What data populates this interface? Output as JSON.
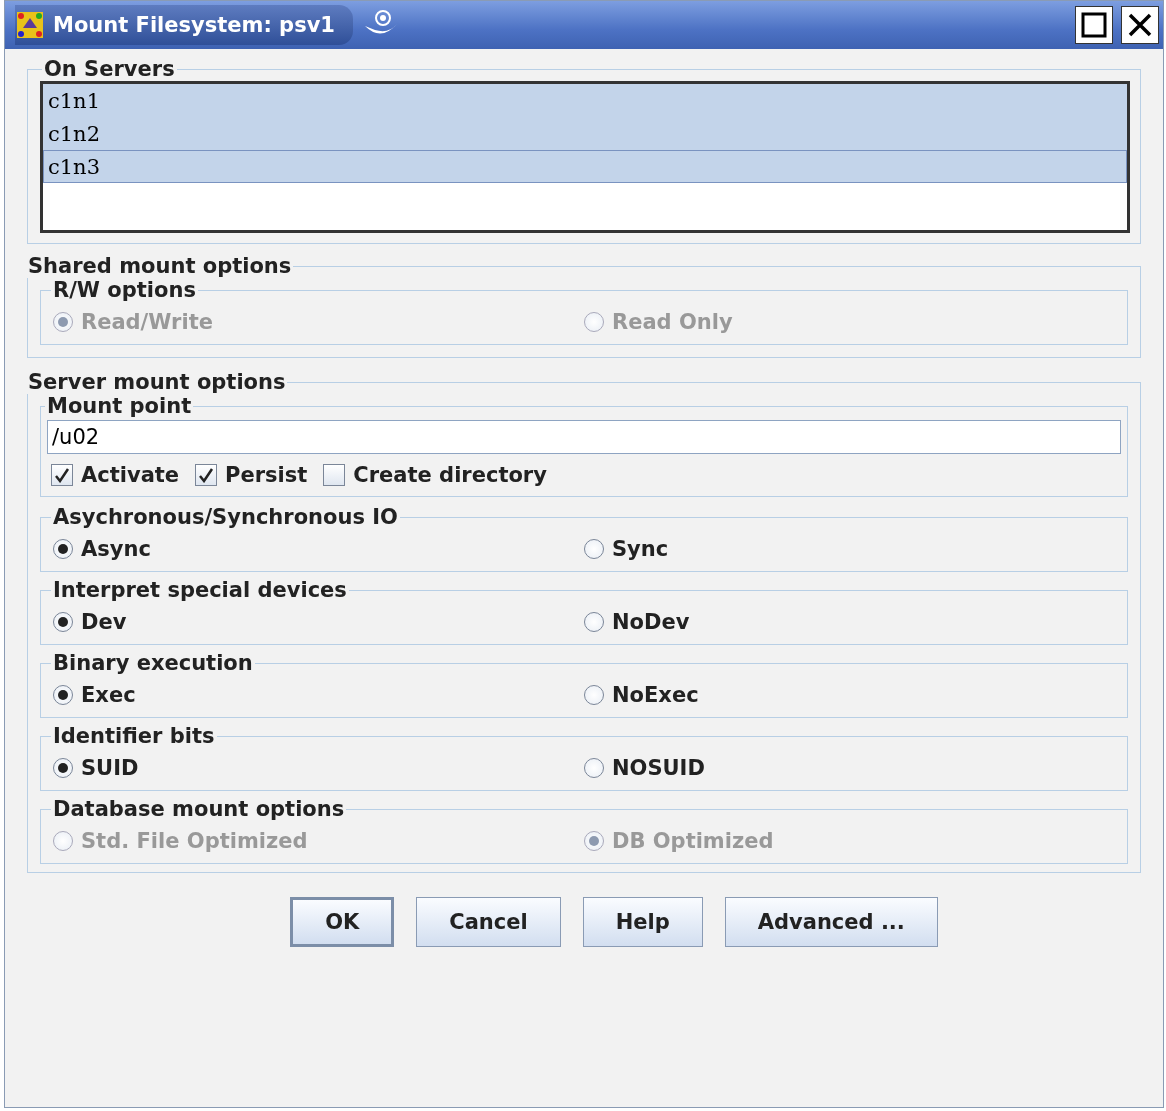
{
  "window": {
    "title": "Mount Filesystem: psv1"
  },
  "servers": {
    "title": "On Servers",
    "items": [
      {
        "label": "c1n1",
        "selected": true,
        "focused": false
      },
      {
        "label": "c1n2",
        "selected": true,
        "focused": false
      },
      {
        "label": "c1n3",
        "selected": true,
        "focused": true
      }
    ]
  },
  "shared": {
    "title": "Shared mount options",
    "groups": [
      {
        "title": "R/W options",
        "disabled": true,
        "options": [
          {
            "label": "Read/Write",
            "selected": true
          },
          {
            "label": "Read Only",
            "selected": false
          }
        ]
      }
    ]
  },
  "server": {
    "title": "Server mount options",
    "mount_point": {
      "title": "Mount point",
      "value": "/u02",
      "checks": [
        {
          "label": "Activate",
          "checked": true
        },
        {
          "label": "Persist",
          "checked": true
        },
        {
          "label": "Create directory",
          "checked": false
        }
      ]
    },
    "groups": [
      {
        "title": "Asychronous/Synchronous IO",
        "disabled": false,
        "options": [
          {
            "label": "Async",
            "selected": true
          },
          {
            "label": "Sync",
            "selected": false
          }
        ]
      },
      {
        "title": "Interpret special devices",
        "disabled": false,
        "options": [
          {
            "label": "Dev",
            "selected": true
          },
          {
            "label": "NoDev",
            "selected": false
          }
        ]
      },
      {
        "title": "Binary execution",
        "disabled": false,
        "options": [
          {
            "label": "Exec",
            "selected": true
          },
          {
            "label": "NoExec",
            "selected": false
          }
        ]
      },
      {
        "title": "Identifier bits",
        "disabled": false,
        "options": [
          {
            "label": "SUID",
            "selected": true
          },
          {
            "label": "NOSUID",
            "selected": false
          }
        ]
      },
      {
        "title": "Database mount options",
        "disabled": true,
        "options": [
          {
            "label": "Std. File Optimized",
            "selected": false
          },
          {
            "label": "DB Optimized",
            "selected": true
          }
        ]
      }
    ]
  },
  "buttons": [
    {
      "label": "OK",
      "default": true
    },
    {
      "label": "Cancel",
      "default": false
    },
    {
      "label": "Help",
      "default": false
    },
    {
      "label": "Advanced ...",
      "default": false
    }
  ]
}
